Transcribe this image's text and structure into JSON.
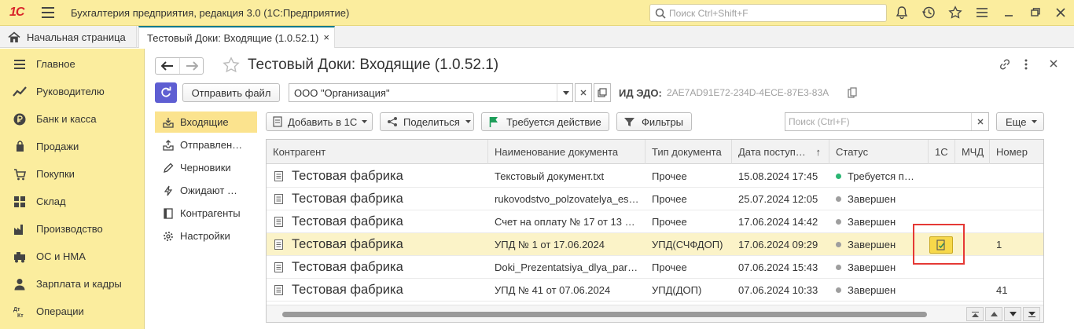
{
  "topbar": {
    "logo": "1С",
    "app_title": "Бухгалтерия предприятия, редакция 3.0  (1С:Предприятие)",
    "search_placeholder": "Поиск Ctrl+Shift+F",
    "icons": [
      "bell-icon",
      "history-icon",
      "star-icon",
      "menu-icon",
      "restore-window-icon",
      "close-icon"
    ]
  },
  "tabs": {
    "home_label": "Начальная страница",
    "active_tab_label": "Тестовый Доки: Входящие (1.0.52.1)",
    "close_symbol": "×"
  },
  "sidebar": {
    "items": [
      {
        "label": "Главное",
        "icon": "list-icon"
      },
      {
        "label": "Руководителю",
        "icon": "chart-icon"
      },
      {
        "label": "Банк и касса",
        "icon": "ruble-icon"
      },
      {
        "label": "Продажи",
        "icon": "cart-icon"
      },
      {
        "label": "Покупки",
        "icon": "basket-icon"
      },
      {
        "label": "Склад",
        "icon": "grid-icon"
      },
      {
        "label": "Производство",
        "icon": "factory-icon"
      },
      {
        "label": "ОС и НМА",
        "icon": "machine-icon"
      },
      {
        "label": "Зарплата и кадры",
        "icon": "person-icon"
      },
      {
        "label": "Операции",
        "icon": "dtkt-icon"
      }
    ]
  },
  "header": {
    "title": "Тестовый Доки: Входящие (1.0.52.1)"
  },
  "toolbar": {
    "send_file_label": "Отправить файл",
    "organization_value": "ООО \"Организация\"",
    "edo_id_label": "ИД ЭДО:",
    "edo_id_value": "2AE7AD91E72-234D-4ECE-87E3-83A",
    "add_label": "Добавить в 1С",
    "share_label": "Поделиться",
    "action_required_label": "Требуется действие",
    "filters_label": "Фильтры",
    "search_placeholder": "Поиск (Ctrl+F)",
    "more_label": "Еще"
  },
  "subnav": {
    "items": [
      {
        "label": "Входящие",
        "icon": "inbox-icon",
        "active": true
      },
      {
        "label": "Отправлен…",
        "icon": "outbox-icon",
        "active": false
      },
      {
        "label": "Черновики",
        "icon": "pencil-icon",
        "active": false
      },
      {
        "label": "Ожидают …",
        "icon": "lightning-icon",
        "active": false
      },
      {
        "label": "Контрагенты",
        "icon": "contacts-icon",
        "active": false
      },
      {
        "label": "Настройки",
        "icon": "gear-icon",
        "active": false
      }
    ]
  },
  "table": {
    "columns": [
      "Контрагент",
      "Наименование документа",
      "Тип документа",
      "Дата поступ…",
      "Статус",
      "1С",
      "МЧД",
      "Номер"
    ],
    "sort_indicator": "↑",
    "rows": [
      {
        "counterparty": "Тестовая фабрика",
        "name": "Текстовый документ.txt",
        "type": "Прочее",
        "date": "15.08.2024 17:45",
        "status": "Требуется п…",
        "status_color": "#2bb673",
        "number": "",
        "has_1c": false
      },
      {
        "counterparty": "Тестовая фабрика",
        "name": "rukovodstvo_polzovatelya_es…",
        "type": "Прочее",
        "date": "25.07.2024 12:05",
        "status": "Завершен",
        "status_color": "#9e9e9e",
        "number": "",
        "has_1c": false
      },
      {
        "counterparty": "Тестовая фабрика",
        "name": "Счет на оплату № 17 от 13 …",
        "type": "Прочее",
        "date": "17.06.2024 14:42",
        "status": "Завершен",
        "status_color": "#9e9e9e",
        "number": "",
        "has_1c": false
      },
      {
        "counterparty": "Тестовая фабрика",
        "name": "УПД № 1 от 17.06.2024",
        "type": "УПД(СЧФДОП)",
        "date": "17.06.2024 09:29",
        "status": "Завершен",
        "status_color": "#9e9e9e",
        "number": "1",
        "has_1c": true
      },
      {
        "counterparty": "Тестовая фабрика",
        "name": "Doki_Prezentatsiya_dlya_par…",
        "type": "Прочее",
        "date": "07.06.2024 15:43",
        "status": "Завершен",
        "status_color": "#9e9e9e",
        "number": "",
        "has_1c": false
      },
      {
        "counterparty": "Тестовая фабрика",
        "name": "УПД № 41 от 07.06.2024",
        "type": "УПД(ДОП)",
        "date": "07.06.2024 10:33",
        "status": "Завершен",
        "status_color": "#9e9e9e",
        "number": "41",
        "has_1c": false
      }
    ]
  }
}
